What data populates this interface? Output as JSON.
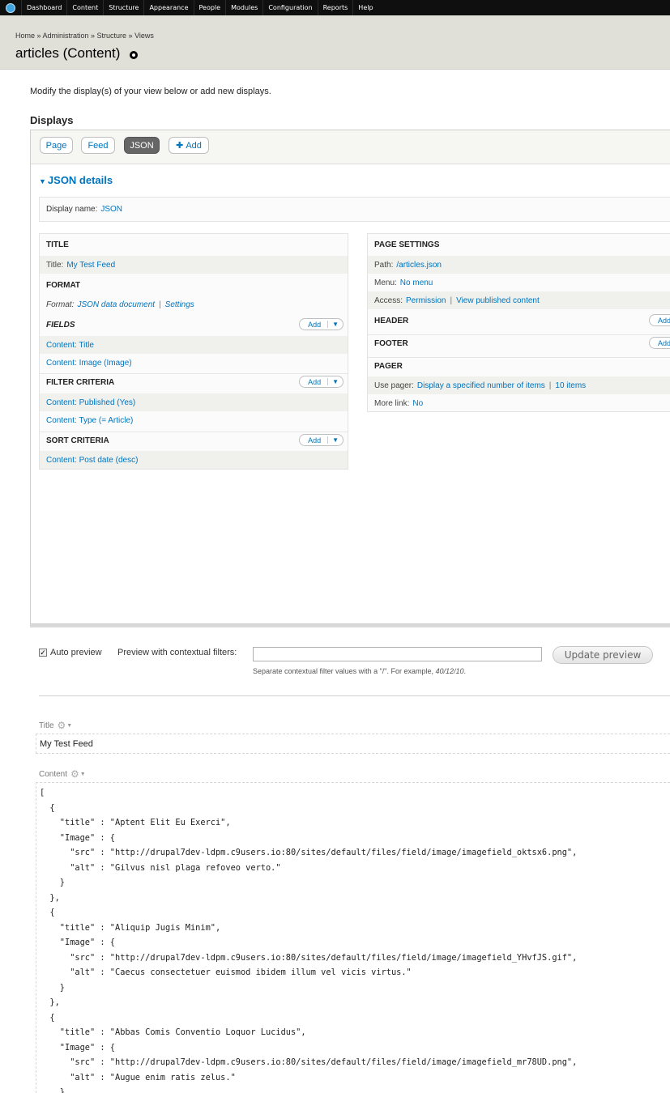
{
  "toolbar": {
    "items": [
      "Dashboard",
      "Content",
      "Structure",
      "Appearance",
      "People",
      "Modules",
      "Configuration",
      "Reports",
      "Help"
    ]
  },
  "header": {
    "breadcrumb": "Home » Administration » Structure » Views",
    "title": "articles (Content)"
  },
  "intro": "Modify the display(s) of your view below or add new displays.",
  "displays": {
    "heading": "Displays",
    "tabs": [
      "Page",
      "Feed",
      "JSON"
    ],
    "add_label": "Add",
    "details_title": "JSON details",
    "display_name_label": "Display name:",
    "display_name_value": "JSON"
  },
  "left": {
    "title_head": "TITLE",
    "title_label": "Title:",
    "title_value": "My Test Feed",
    "format_head": "FORMAT",
    "format_label": "Format:",
    "format_value": "JSON data document",
    "format_settings": "Settings",
    "fields_head": "FIELDS",
    "fields": [
      "Content: Title",
      "Content: Image (Image)"
    ],
    "filter_head": "FILTER CRITERIA",
    "filters": [
      "Content: Published (Yes)",
      "Content: Type (= Article)"
    ],
    "sort_head": "SORT CRITERIA",
    "sorts": [
      "Content: Post date (desc)"
    ],
    "add": "Add"
  },
  "right": {
    "page_settings_head": "PAGE SETTINGS",
    "path_label": "Path:",
    "path_value": "/articles.json",
    "menu_label": "Menu:",
    "menu_value": "No menu",
    "access_label": "Access:",
    "access_value": "Permission",
    "access_value2": "View published content",
    "header_head": "HEADER",
    "footer_head": "FOOTER",
    "pager_head": "PAGER",
    "pager_label": "Use pager:",
    "pager_value": "Display a specified number of items",
    "pager_value2": "10 items",
    "more_label": "More link:",
    "more_value": "No",
    "add": "Add"
  },
  "preview": {
    "auto_preview": "Auto preview",
    "auto_checked": true,
    "ctx_label": "Preview with contextual filters:",
    "ctx_value": "",
    "ctx_desc_prefix": "Separate contextual filter values with a \"/\". For example, ",
    "ctx_desc_example": "40/12/10",
    "update_button": "Update preview",
    "title_label": "Title",
    "title_value": "My Test Feed",
    "content_label": "Content",
    "json": "[\n  {\n    \"title\" : \"Aptent Elit Eu Exerci\",\n    \"Image\" : {\n      \"src\" : \"http://drupal7dev-ldpm.c9users.io:80/sites/default/files/field/image/imagefield_oktsx6.png\",\n      \"alt\" : \"Gilvus nisl plaga refoveo verto.\"\n    }\n  },\n  {\n    \"title\" : \"Aliquip Jugis Minim\",\n    \"Image\" : {\n      \"src\" : \"http://drupal7dev-ldpm.c9users.io:80/sites/default/files/field/image/imagefield_YHvfJS.gif\",\n      \"alt\" : \"Caecus consectetuer euismod ibidem illum vel vicis virtus.\"\n    }\n  },\n  {\n    \"title\" : \"Abbas Comis Conventio Loquor Lucidus\",\n    \"Image\" : {\n      \"src\" : \"http://drupal7dev-ldpm.c9users.io:80/sites/default/files/field/image/imagefield_mr78UD.png\",\n      \"alt\" : \"Augue enim ratis zelus.\"\n    }"
  }
}
